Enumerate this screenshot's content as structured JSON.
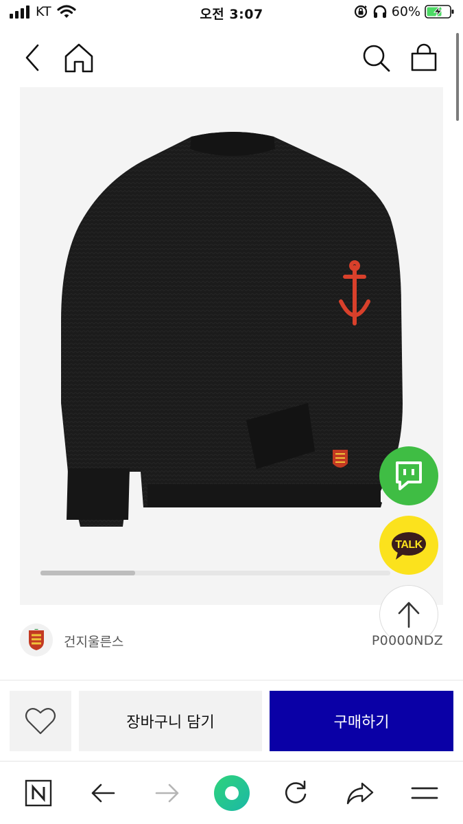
{
  "status_bar": {
    "carrier": "KT",
    "time": "오전 3:07",
    "battery_percent": "60%",
    "icons": [
      "signal-bars-icon",
      "wifi-icon",
      "orientation-lock-icon",
      "headphones-icon",
      "battery-charging-icon"
    ]
  },
  "top_nav": {
    "icons": [
      "back-arrow-icon",
      "home-icon",
      "search-icon",
      "shopping-bag-icon"
    ]
  },
  "product": {
    "image_subject": "black-knit-sweater-with-red-anchor",
    "image_progress": 0.27,
    "brand_name": "건지울른스",
    "product_code": "P0000NDZ"
  },
  "floating": {
    "chat_icon": "chat-bubble-icon",
    "talk_label": "TALK",
    "top_icon": "arrow-up-icon"
  },
  "purchase_bar": {
    "wish_icon": "heart-icon",
    "cart_label": "장바구니 담기",
    "buy_label": "구매하기"
  },
  "browser_toolbar": {
    "icons": [
      "naver-n-icon",
      "back-icon",
      "forward-icon",
      "green-dot-icon",
      "reload-icon",
      "share-icon",
      "menu-icon"
    ]
  },
  "colors": {
    "buy_button": "#0a00a6",
    "chat_fab": "#3fbd44",
    "talk_fab": "#fbe21d",
    "anchor_red": "#d8402b"
  }
}
